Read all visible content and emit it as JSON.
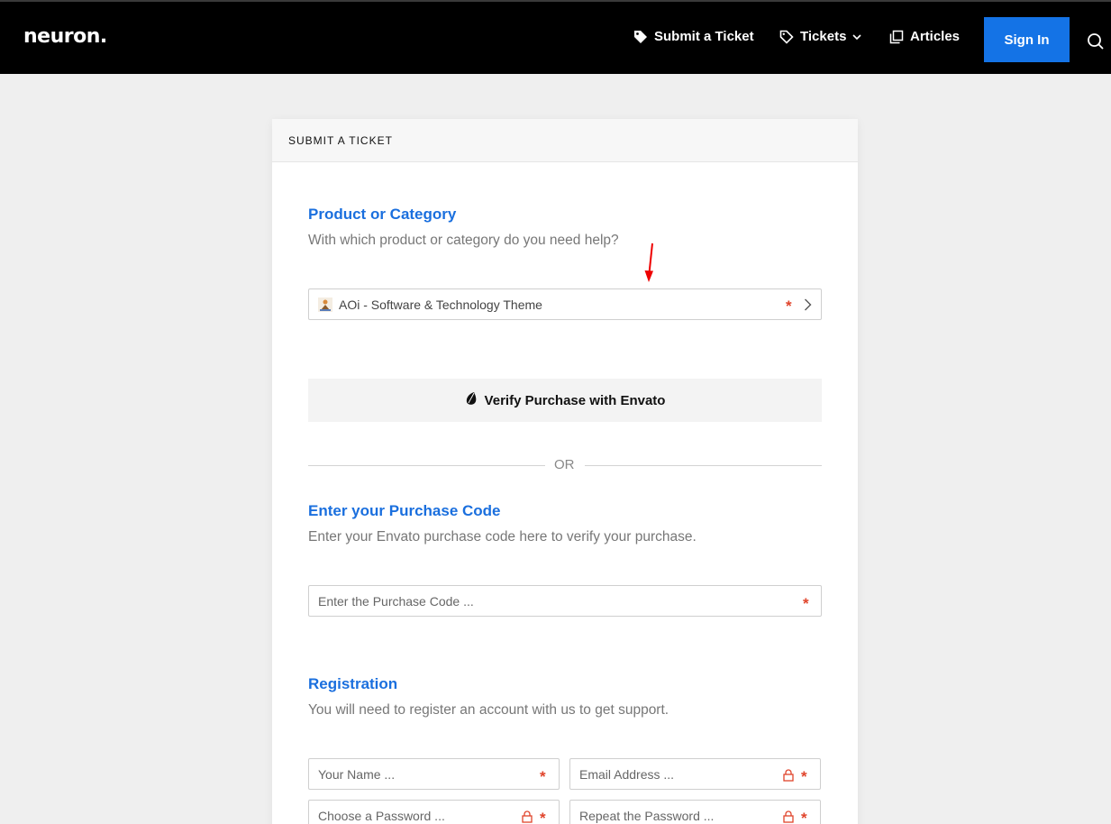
{
  "header": {
    "logo": "neuron.",
    "nav": [
      {
        "label": "Submit a Ticket",
        "icon": "tag-filled-icon"
      },
      {
        "label": "Tickets",
        "icon": "tag-outline-icon"
      },
      {
        "label": "Articles",
        "icon": "copy-icon"
      }
    ],
    "signin_label": "Sign In",
    "accent": "#1473e6"
  },
  "card": {
    "header": "SUBMIT A TICKET",
    "product": {
      "title": "Product or Category",
      "description": "With which product or category do you need help?",
      "selected": "AOi - Software & Technology Theme"
    },
    "verify_label": "Verify Purchase with Envato",
    "or_label": "OR",
    "purchase": {
      "title": "Enter your Purchase Code",
      "description": "Enter your Envato purchase code here to verify your purchase.",
      "placeholder": "Enter the Purchase Code ..."
    },
    "registration": {
      "title": "Registration",
      "description": "You will need to register an account with us to get support.",
      "name_placeholder": "Your Name ...",
      "email_placeholder": "Email Address ...",
      "password_placeholder": "Choose a Password ...",
      "repeat_placeholder": "Repeat the Password ..."
    },
    "title_color": "#1a6fde",
    "required_color": "#e0442b"
  },
  "required_mark": "*"
}
